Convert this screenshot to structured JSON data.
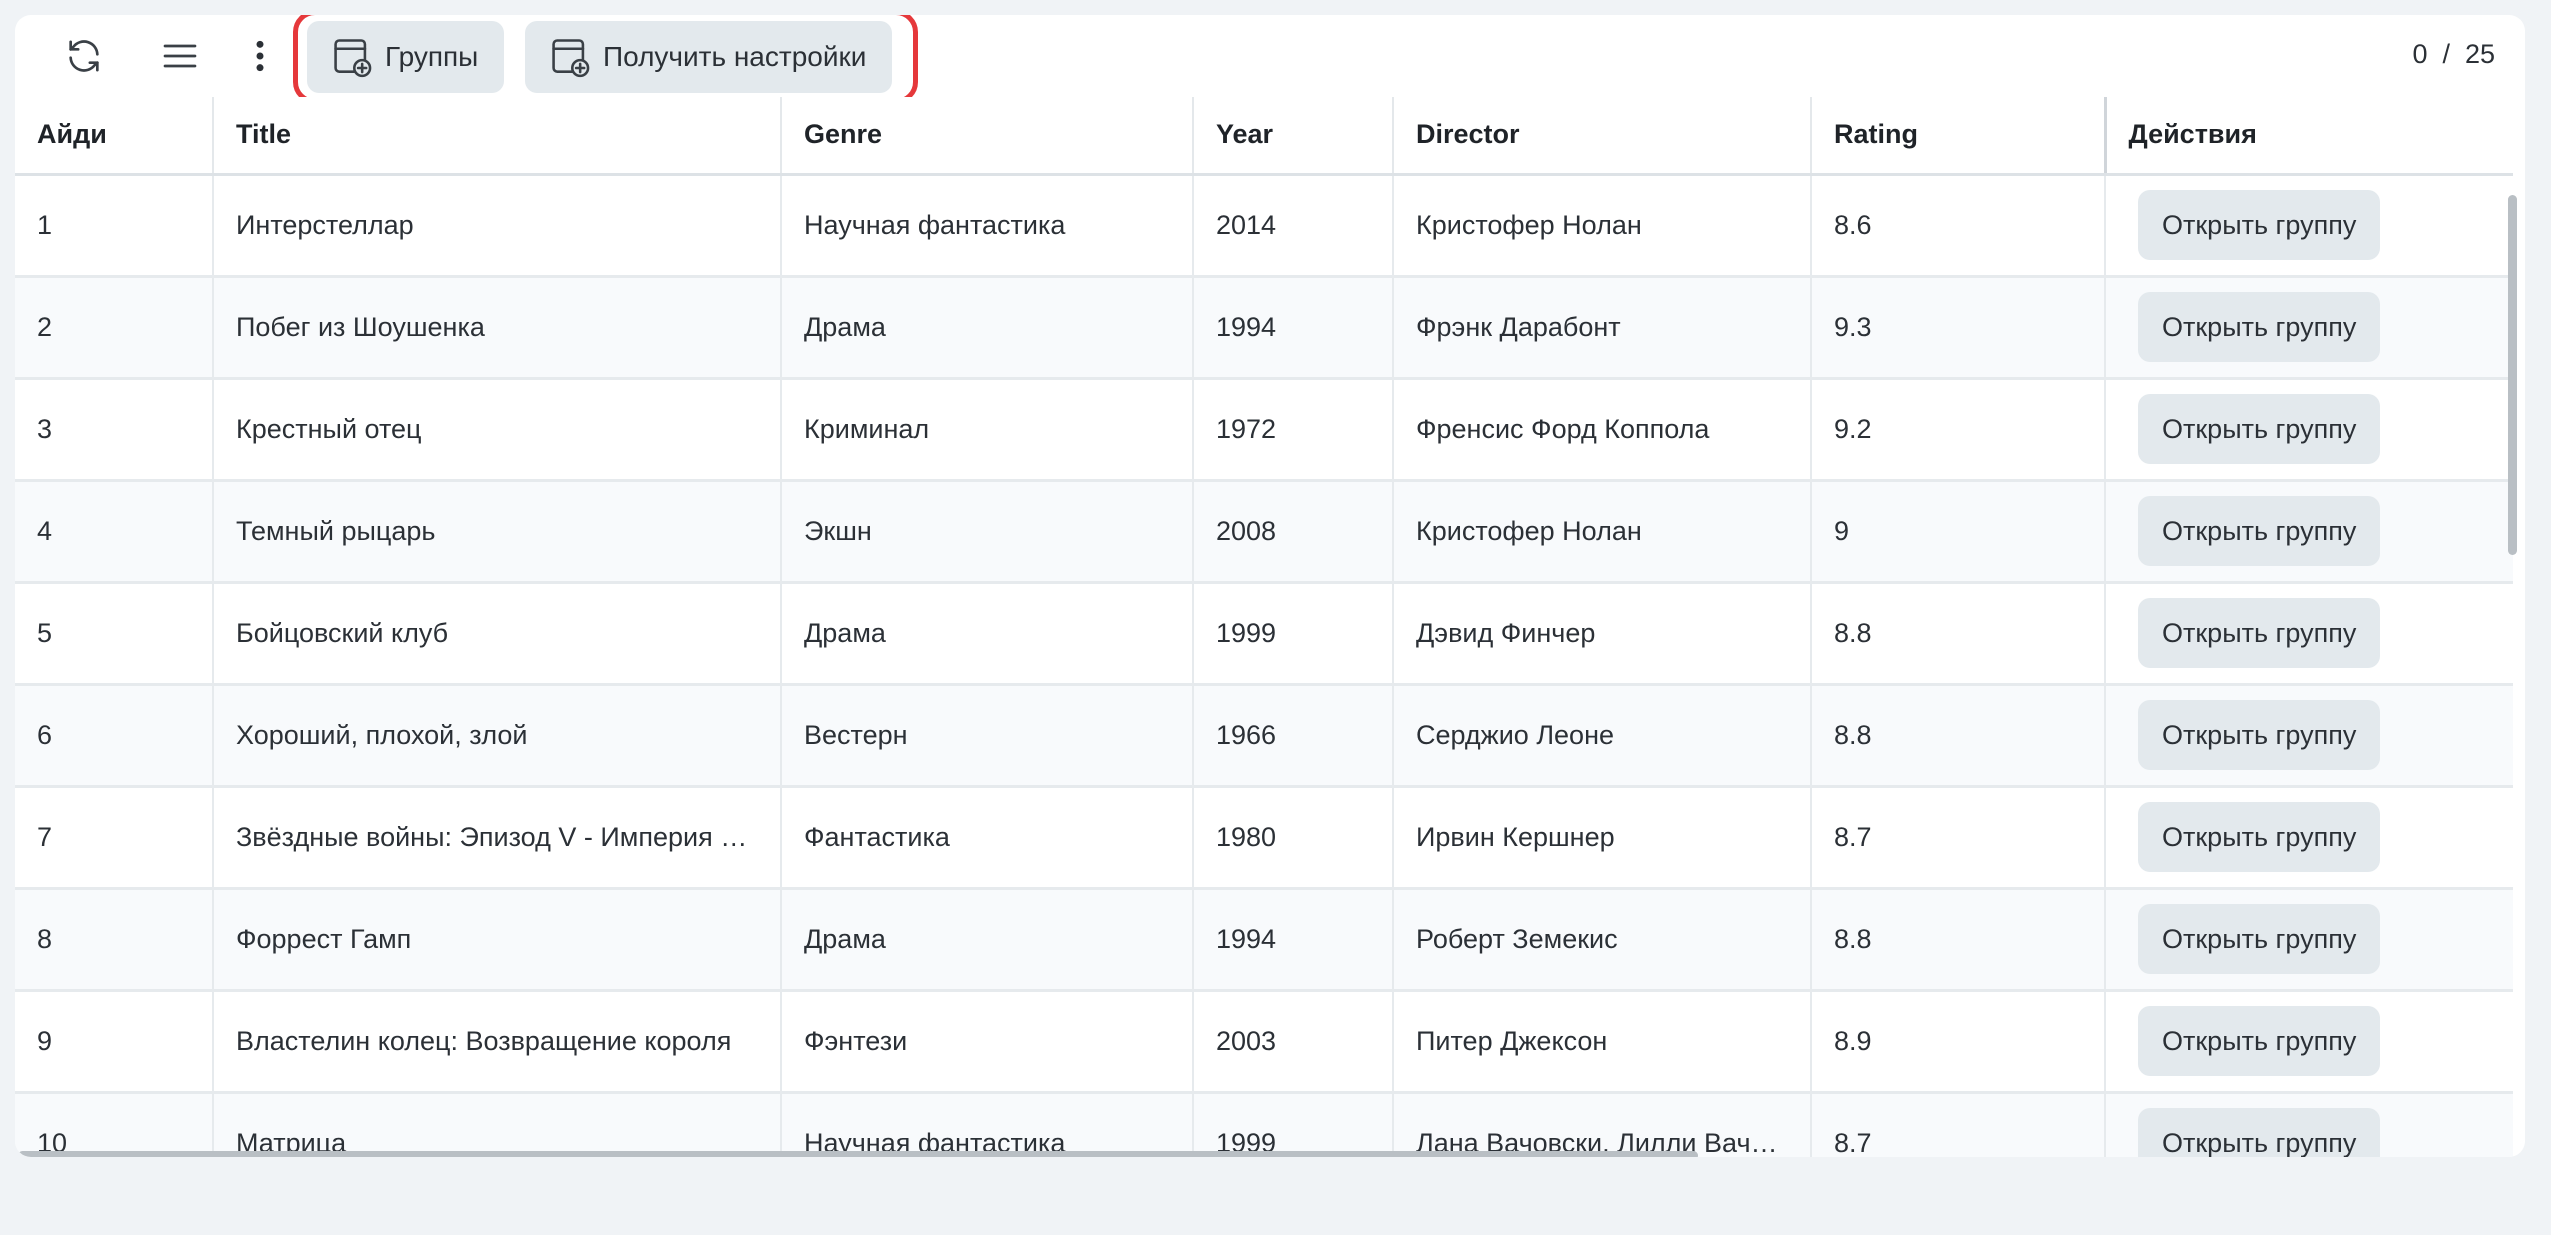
{
  "toolbar": {
    "groups_label": "Группы",
    "settings_label": "Получить настройки",
    "counter": "0  /  25"
  },
  "table": {
    "columns": [
      "Айди",
      "Title",
      "Genre",
      "Year",
      "Director",
      "Rating",
      "Действия"
    ],
    "rows": [
      {
        "id": "1",
        "title": "Интерстеллар",
        "genre": "Научная фантастика",
        "year": "2014",
        "director": "Кристофер Нолан",
        "rating": "8.6",
        "action": "Открыть группу"
      },
      {
        "id": "2",
        "title": "Побег из Шоушенка",
        "genre": "Драма",
        "year": "1994",
        "director": "Фрэнк Дарабонт",
        "rating": "9.3",
        "action": "Открыть группу"
      },
      {
        "id": "3",
        "title": "Крестный отец",
        "genre": "Криминал",
        "year": "1972",
        "director": "Френсис Форд Коппола",
        "rating": "9.2",
        "action": "Открыть группу"
      },
      {
        "id": "4",
        "title": "Темный рыцарь",
        "genre": "Экшн",
        "year": "2008",
        "director": "Кристофер Нолан",
        "rating": "9",
        "action": "Открыть группу"
      },
      {
        "id": "5",
        "title": "Бойцовский клуб",
        "genre": "Драма",
        "year": "1999",
        "director": "Дэвид Финчер",
        "rating": "8.8",
        "action": "Открыть группу"
      },
      {
        "id": "6",
        "title": "Хороший, плохой, злой",
        "genre": "Вестерн",
        "year": "1966",
        "director": "Серджио Леоне",
        "rating": "8.8",
        "action": "Открыть группу"
      },
      {
        "id": "7",
        "title": "Звёздные войны: Эпизод V - Империя наносит ответный удар",
        "genre": "Фантастика",
        "year": "1980",
        "director": "Ирвин Кершнер",
        "rating": "8.7",
        "action": "Открыть группу"
      },
      {
        "id": "8",
        "title": "Форрест Гамп",
        "genre": "Драма",
        "year": "1994",
        "director": "Роберт Земекис",
        "rating": "8.8",
        "action": "Открыть группу"
      },
      {
        "id": "9",
        "title": "Властелин колец: Возвращение короля",
        "genre": "Фэнтези",
        "year": "2003",
        "director": "Питер Джексон",
        "rating": "8.9",
        "action": "Открыть группу"
      },
      {
        "id": "10",
        "title": "Матрица",
        "genre": "Научная фантастика",
        "year": "1999",
        "director": "Лана Вачовски, Лилли Вачовски",
        "rating": "8.7",
        "action": "Открыть группу"
      }
    ]
  },
  "icons": {
    "refresh": "refresh-icon",
    "menu": "hamburger-menu-icon",
    "more": "kebab-more-icon",
    "add_window": "window-plus-icon"
  },
  "colors": {
    "highlight": "#e5383b",
    "button_bg": "#e3e9ed"
  }
}
